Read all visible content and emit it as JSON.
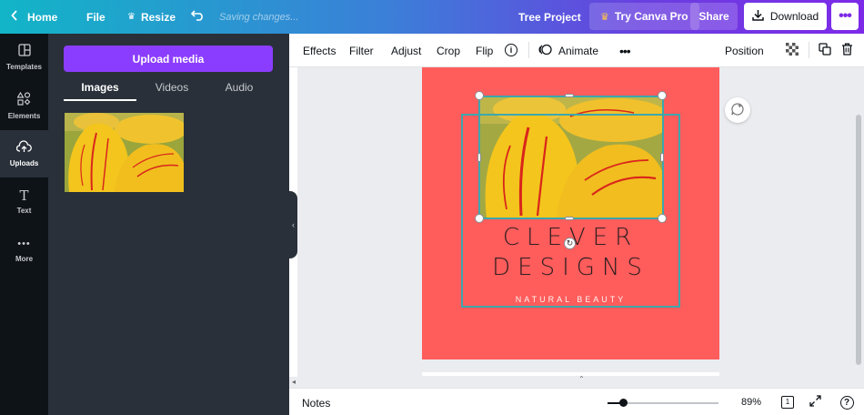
{
  "topbar": {
    "home": "Home",
    "file": "File",
    "resize": "Resize",
    "saving": "Saving changes...",
    "project_title": "Tree Project",
    "try_pro": "Try Canva Pro",
    "share": "Share",
    "download": "Download"
  },
  "rail": {
    "items": [
      {
        "label": "Templates"
      },
      {
        "label": "Elements"
      },
      {
        "label": "Uploads"
      },
      {
        "label": "Text"
      },
      {
        "label": "More"
      }
    ]
  },
  "panel": {
    "upload_button": "Upload media",
    "tabs": [
      {
        "label": "Images"
      },
      {
        "label": "Videos"
      },
      {
        "label": "Audio"
      }
    ]
  },
  "toolbar": {
    "effects": "Effects",
    "filter": "Filter",
    "adjust": "Adjust",
    "crop": "Crop",
    "flip": "Flip",
    "animate": "Animate",
    "position": "Position"
  },
  "design": {
    "title_line1": "CLEVER",
    "title_line2": "DESIGNS",
    "subtitle": "NATURAL BEAUTY"
  },
  "footer": {
    "notes": "Notes",
    "zoom": "89%",
    "zoom_fraction": 0.14,
    "page_count": "1"
  },
  "colors": {
    "accent": "#8b3dff",
    "page_background": "#ff5c5c",
    "selection": "#3ca7ad"
  }
}
